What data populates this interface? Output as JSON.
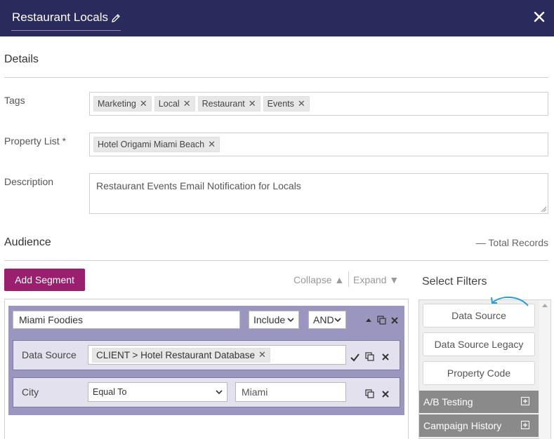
{
  "header": {
    "title": "Restaurant Locals",
    "edit_icon": "pencil-icon",
    "close_icon": "close-icon"
  },
  "details": {
    "heading": "Details",
    "tags_label": "Tags",
    "tags": [
      "Marketing",
      "Local",
      "Restaurant",
      "Events"
    ],
    "property_label": "Property List *",
    "properties": [
      "Hotel Origami Miami Beach"
    ],
    "description_label": "Description",
    "description_value": "Restaurant Events Email Notification for Locals"
  },
  "audience": {
    "heading": "Audience",
    "total_records": "— Total Records",
    "add_segment_label": "Add Segment",
    "collapse_label": "Collapse ▲",
    "expand_label": "Expand ▼",
    "segment": {
      "name_value": "Miami Foodies",
      "include_value": "Include",
      "logic_value": "AND",
      "rows": [
        {
          "label": "Data Source",
          "chip": "CLIENT > Hotel Restaurant Database"
        },
        {
          "label": "City",
          "operator_value": "Equal To",
          "value": "Miami"
        }
      ]
    }
  },
  "filters": {
    "heading": "Select Filters",
    "buttons": [
      "Data Source",
      "Data Source Legacy",
      "Property Code"
    ],
    "groups": [
      "A/B Testing",
      "Campaign History"
    ]
  },
  "colors": {
    "header_bg": "#2a2a5c",
    "accent_button": "#9a1f6e",
    "segment_bg": "#9a96bf",
    "row_bg": "#e3e1ee",
    "filter_group_bg": "#8a8a8a",
    "arrow": "#2a9bd6"
  }
}
